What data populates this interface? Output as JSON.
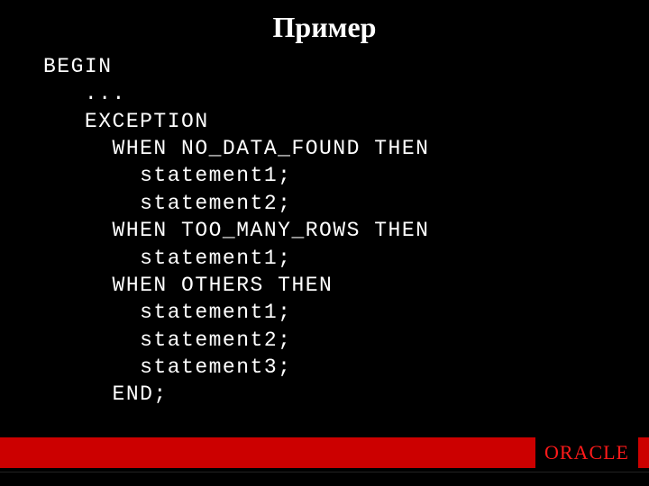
{
  "title": "Пример",
  "code": {
    "l0": "BEGIN",
    "l1": "   ...",
    "l2": "   EXCEPTION",
    "l3": "     WHEN NO_DATA_FOUND THEN",
    "l4": "       statement1;",
    "l5": "       statement2;",
    "l6": "     WHEN TOO_MANY_ROWS THEN",
    "l7": "       statement1;",
    "l8": "     WHEN OTHERS THEN",
    "l9": "       statement1;",
    "l10": "       statement2;",
    "l11": "       statement3;",
    "l12": "     END;"
  },
  "footer": {
    "brand": "ORACLE"
  }
}
